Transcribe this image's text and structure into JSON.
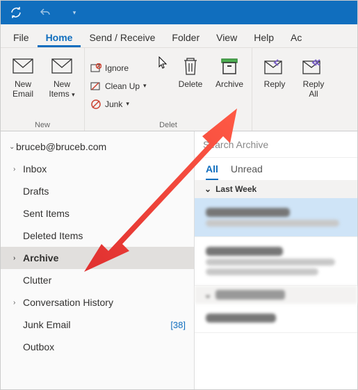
{
  "menubar": {
    "file": "File",
    "home": "Home",
    "sendreceive": "Send / Receive",
    "folder": "Folder",
    "view": "View",
    "help": "Help",
    "account": "Ac"
  },
  "ribbon": {
    "new_email": "New\nEmail",
    "new_items": "New\nItems",
    "group_new": "New",
    "ignore": "Ignore",
    "cleanup": "Clean Up",
    "junk": "Junk",
    "delete": "Delete",
    "archive": "Archive",
    "group_delete": "Delet",
    "reply": "Reply",
    "reply_all": "Reply\nAll"
  },
  "nav": {
    "account": "bruceb@bruceb.com",
    "inbox": "Inbox",
    "drafts": "Drafts",
    "sent": "Sent Items",
    "deleted": "Deleted Items",
    "archive": "Archive",
    "clutter": "Clutter",
    "convhist": "Conversation History",
    "junk": "Junk Email",
    "junk_count": "[38]",
    "outbox": "Outbox"
  },
  "list": {
    "search_placeholder": "Search Archive",
    "filter_all": "All",
    "filter_unread": "Unread",
    "group_lastweek": "Last Week"
  }
}
